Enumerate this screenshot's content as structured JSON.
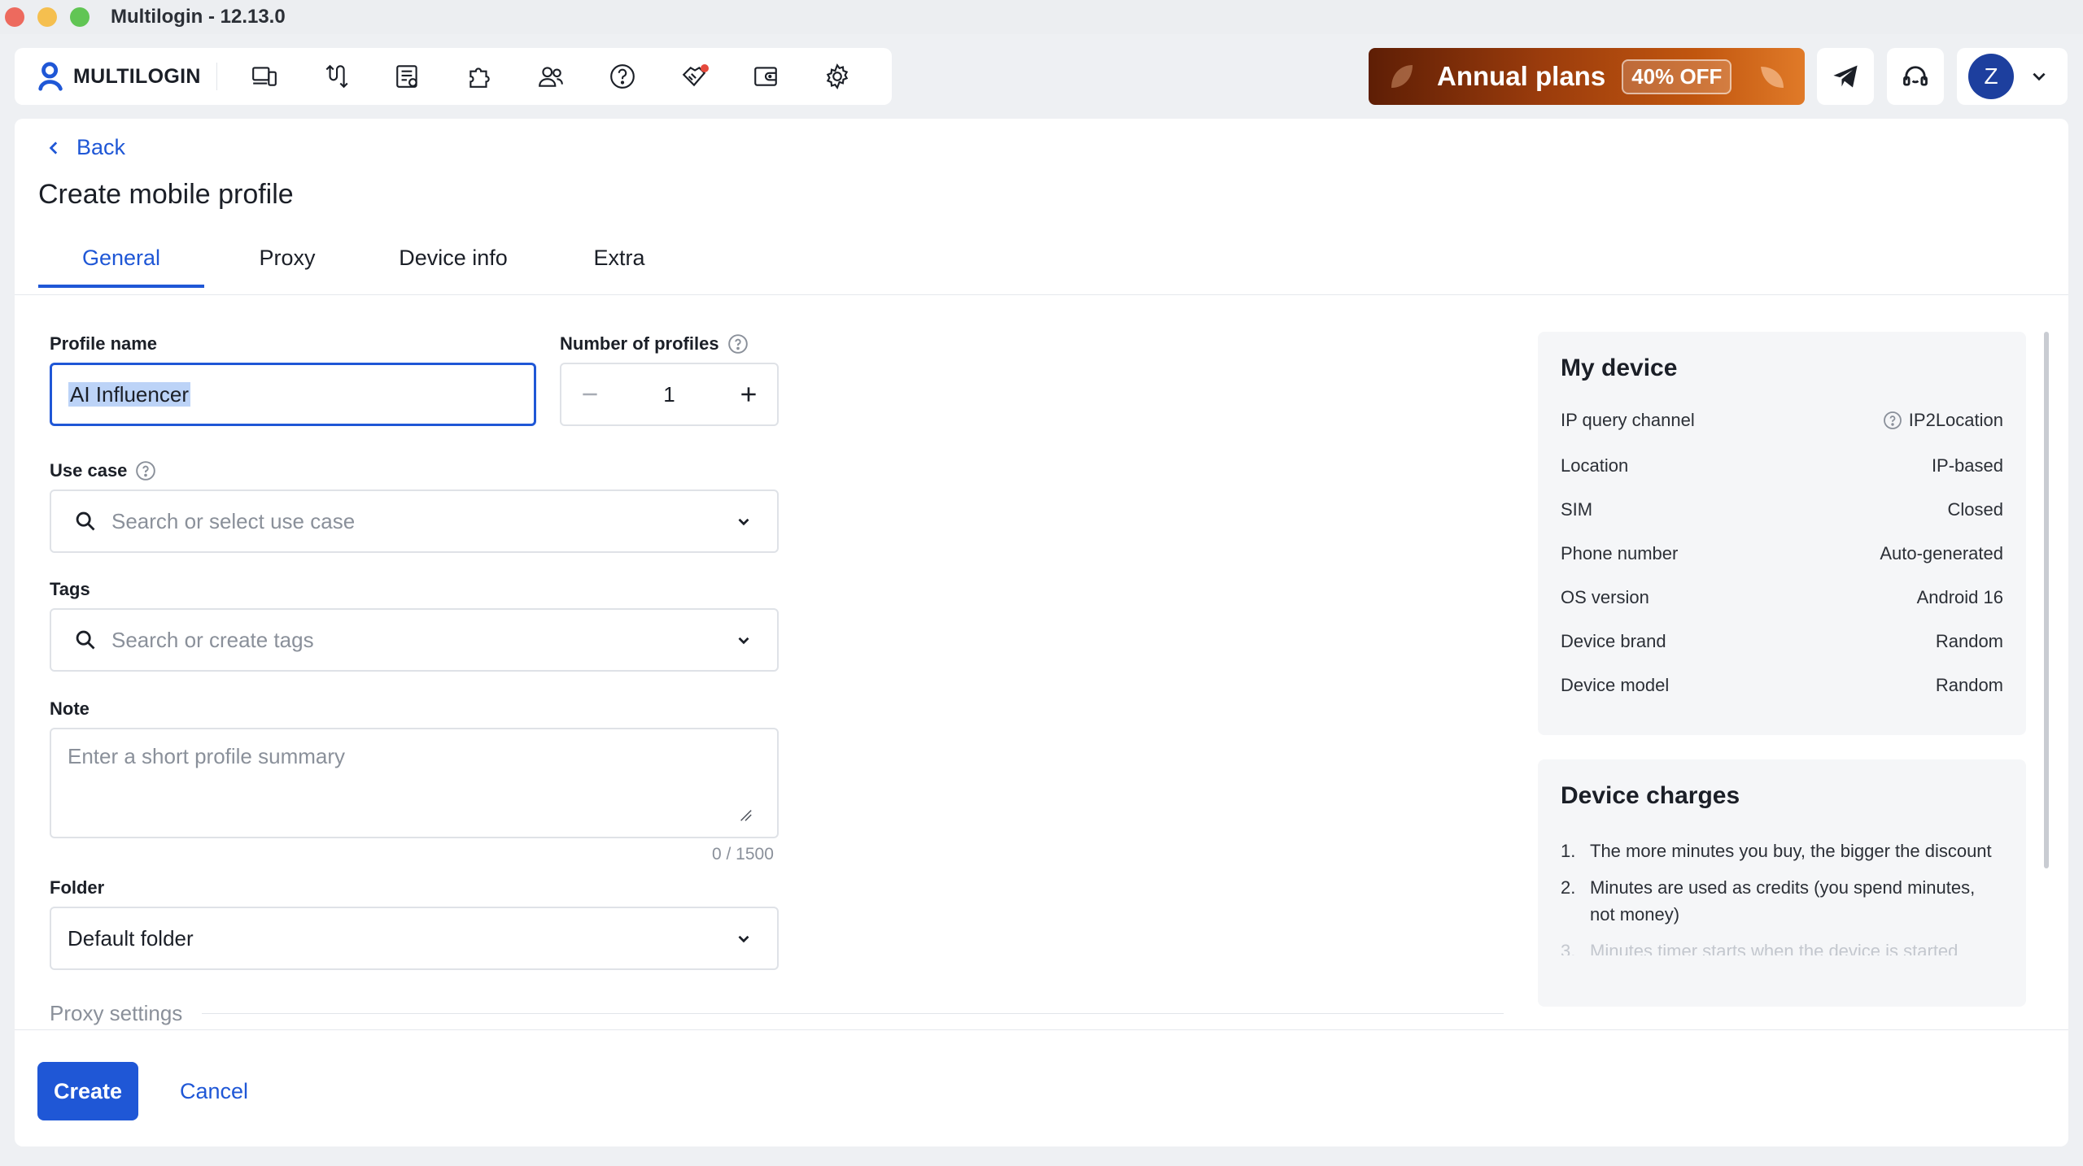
{
  "window": {
    "title": "Multilogin - 12.13.0"
  },
  "nav": {
    "logo_text": "MULTILOGIN",
    "icons": [
      "devices-icon",
      "automation-icon",
      "profiles-list-icon",
      "extensions-icon",
      "team-icon",
      "help-icon",
      "affiliate-icon",
      "wallet-icon",
      "settings-icon"
    ]
  },
  "promo": {
    "text": "Annual plans",
    "badge": "40% OFF"
  },
  "user": {
    "initial": "Z"
  },
  "page": {
    "back_label": "Back",
    "title": "Create mobile profile",
    "tabs": [
      {
        "label": "General",
        "active": true
      },
      {
        "label": "Proxy",
        "active": false
      },
      {
        "label": "Device info",
        "active": false
      },
      {
        "label": "Extra",
        "active": false
      }
    ]
  },
  "form": {
    "profile_name": {
      "label": "Profile name",
      "value": "AI Influencer"
    },
    "number_of_profiles": {
      "label": "Number of profiles",
      "value": "1"
    },
    "use_case": {
      "label": "Use case",
      "placeholder": "Search or select use case"
    },
    "tags": {
      "label": "Tags",
      "placeholder": "Search or create tags"
    },
    "note": {
      "label": "Note",
      "placeholder": "Enter a short profile summary",
      "counter": "0 / 1500"
    },
    "folder": {
      "label": "Folder",
      "value": "Default folder"
    },
    "proxy_section": "Proxy settings"
  },
  "actions": {
    "create_label": "Create",
    "cancel_label": "Cancel"
  },
  "my_device": {
    "title": "My device",
    "rows": [
      {
        "key": "IP query channel",
        "value": "IP2Location"
      },
      {
        "key": "Location",
        "value": "IP-based"
      },
      {
        "key": "SIM",
        "value": "Closed"
      },
      {
        "key": "Phone number",
        "value": "Auto-generated"
      },
      {
        "key": "OS version",
        "value": "Android 16"
      },
      {
        "key": "Device brand",
        "value": "Random"
      },
      {
        "key": "Device model",
        "value": "Random"
      }
    ]
  },
  "device_charges": {
    "title": "Device charges",
    "items": [
      {
        "n": "1.",
        "text": "The more minutes you buy, the bigger the discount"
      },
      {
        "n": "2.",
        "text": "Minutes are used as credits (you spend minutes, not money)"
      },
      {
        "n": "3.",
        "text": "Minutes timer starts when the device is started"
      }
    ]
  },
  "colors": {
    "accent": "#1f57d6",
    "promo": "#9b3c0c",
    "avatar": "#1d3f9e"
  }
}
